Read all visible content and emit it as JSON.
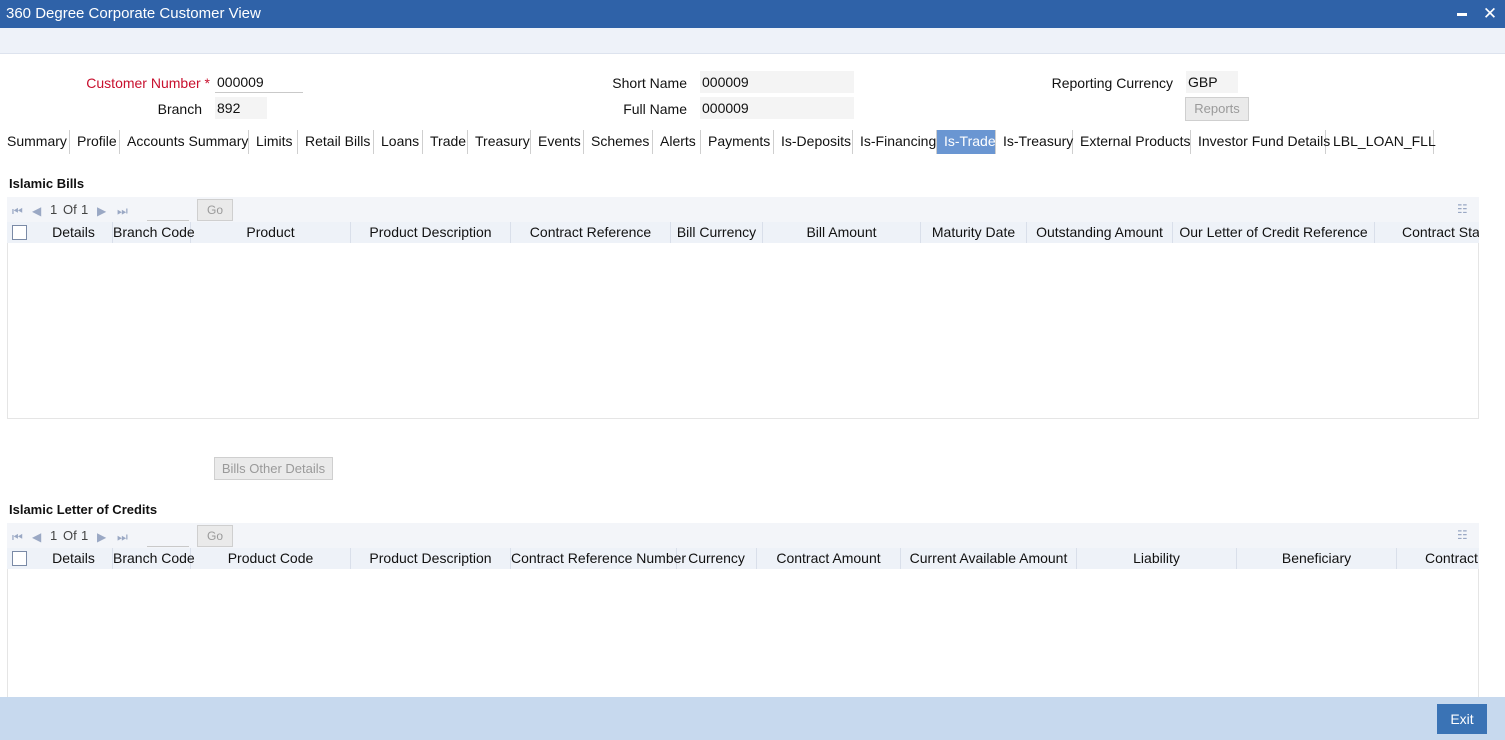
{
  "window": {
    "title": "360 Degree Corporate Customer View"
  },
  "header": {
    "customer_number_label": "Customer Number",
    "required_mark": "*",
    "customer_number": "000009",
    "branch_label": "Branch",
    "branch": "892",
    "short_name_label": "Short Name",
    "short_name": "000009",
    "full_name_label": "Full Name",
    "full_name": "000009",
    "reporting_currency_label": "Reporting Currency",
    "reporting_currency": "GBP",
    "reports_button": "Reports"
  },
  "tabs": [
    {
      "label": "Summary"
    },
    {
      "label": "Profile"
    },
    {
      "label": "Accounts Summary"
    },
    {
      "label": "Limits"
    },
    {
      "label": "Retail Bills"
    },
    {
      "label": "Loans"
    },
    {
      "label": "Trade"
    },
    {
      "label": "Treasury"
    },
    {
      "label": "Events"
    },
    {
      "label": "Schemes"
    },
    {
      "label": "Alerts"
    },
    {
      "label": "Payments"
    },
    {
      "label": "Is-Deposits"
    },
    {
      "label": "Is-Financing"
    },
    {
      "label": "Is-Trade"
    },
    {
      "label": "Is-Treasury"
    },
    {
      "label": "External Products"
    },
    {
      "label": "Investor Fund Details"
    },
    {
      "label": "LBL_LOAN_FLL"
    }
  ],
  "active_tab": "Is-Trade",
  "bills": {
    "title": "Islamic Bills",
    "pager": {
      "current": "1",
      "of": "Of",
      "total": "1",
      "go": "Go"
    },
    "columns": [
      "Details",
      "Branch Code",
      "Product",
      "Product Description",
      "Contract Reference",
      "Bill Currency",
      "Bill Amount",
      "Maturity Date",
      "Outstanding Amount",
      "Our Letter of Credit Reference",
      "Contract Status"
    ],
    "other_details_button": "Bills Other Details"
  },
  "lcs": {
    "title": "Islamic Letter of Credits",
    "pager": {
      "current": "1",
      "of": "Of",
      "total": "1",
      "go": "Go"
    },
    "columns": [
      "Details",
      "Branch Code",
      "Product Code",
      "Product Description",
      "Contract Reference Number",
      "Currency",
      "Contract Amount",
      "Current Available Amount",
      "Liability",
      "Beneficiary",
      "Contract Status"
    ]
  },
  "footer": {
    "exit_button": "Exit"
  },
  "colors": {
    "titlebar": "#2f62a8",
    "active_tab": "#6a96d2",
    "footer": "#c7d9ee",
    "exit": "#3a73b5",
    "required": "#c8102e"
  }
}
